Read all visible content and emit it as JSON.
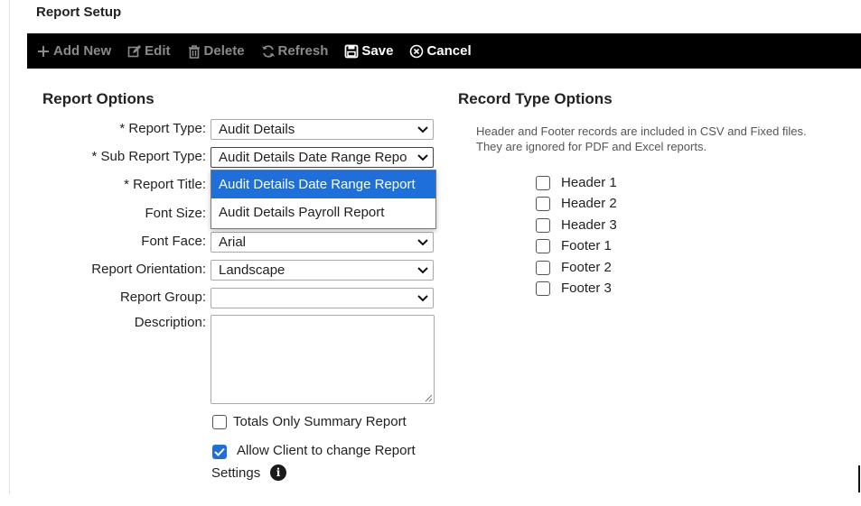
{
  "page": {
    "title": "Report Setup"
  },
  "toolbar": {
    "add_new": "Add New",
    "edit": "Edit",
    "delete": "Delete",
    "refresh": "Refresh",
    "save": "Save",
    "cancel": "Cancel"
  },
  "report_options": {
    "title": "Report Options",
    "report_type": {
      "required": "*",
      "label": "Report Type:",
      "value": "Audit Details"
    },
    "sub_report_type": {
      "required": "*",
      "label": "Sub Report Type:",
      "value": "Audit Details Date Range Repo"
    },
    "report_title": {
      "required": "*",
      "label": "Report Title:"
    },
    "font_size": {
      "label": "Font Size:"
    },
    "font_face": {
      "label": "Font Face:",
      "value": "Arial"
    },
    "orientation": {
      "label": "Report Orientation:",
      "value": "Landscape"
    },
    "group": {
      "label": "Report Group:",
      "value": ""
    },
    "description": {
      "label": "Description:",
      "value": ""
    },
    "totals_only": {
      "label": "Totals Only Summary Report",
      "checked": false
    },
    "allow_client": {
      "label_line1": "Allow Client to change Report",
      "label_line2": "Settings",
      "checked": true
    }
  },
  "dropdown": {
    "options": [
      "Audit Details Date Range Report",
      "Audit Details Payroll Report"
    ],
    "selected_index": 0
  },
  "record_type_options": {
    "title": "Record Type Options",
    "note_line1": "Header and Footer records are included in CSV and Fixed files.",
    "note_line2": "They are ignored for PDF and Excel reports.",
    "items": [
      {
        "label": "Header 1",
        "checked": false
      },
      {
        "label": "Header 2",
        "checked": false
      },
      {
        "label": "Header 3",
        "checked": false
      },
      {
        "label": "Footer 1",
        "checked": false
      },
      {
        "label": "Footer 2",
        "checked": false
      },
      {
        "label": "Footer 3",
        "checked": false
      }
    ]
  },
  "colors": {
    "toolbar_bg": "#000000",
    "accent": "#1e6fd9",
    "disabled_text": "#8a8a8a"
  }
}
